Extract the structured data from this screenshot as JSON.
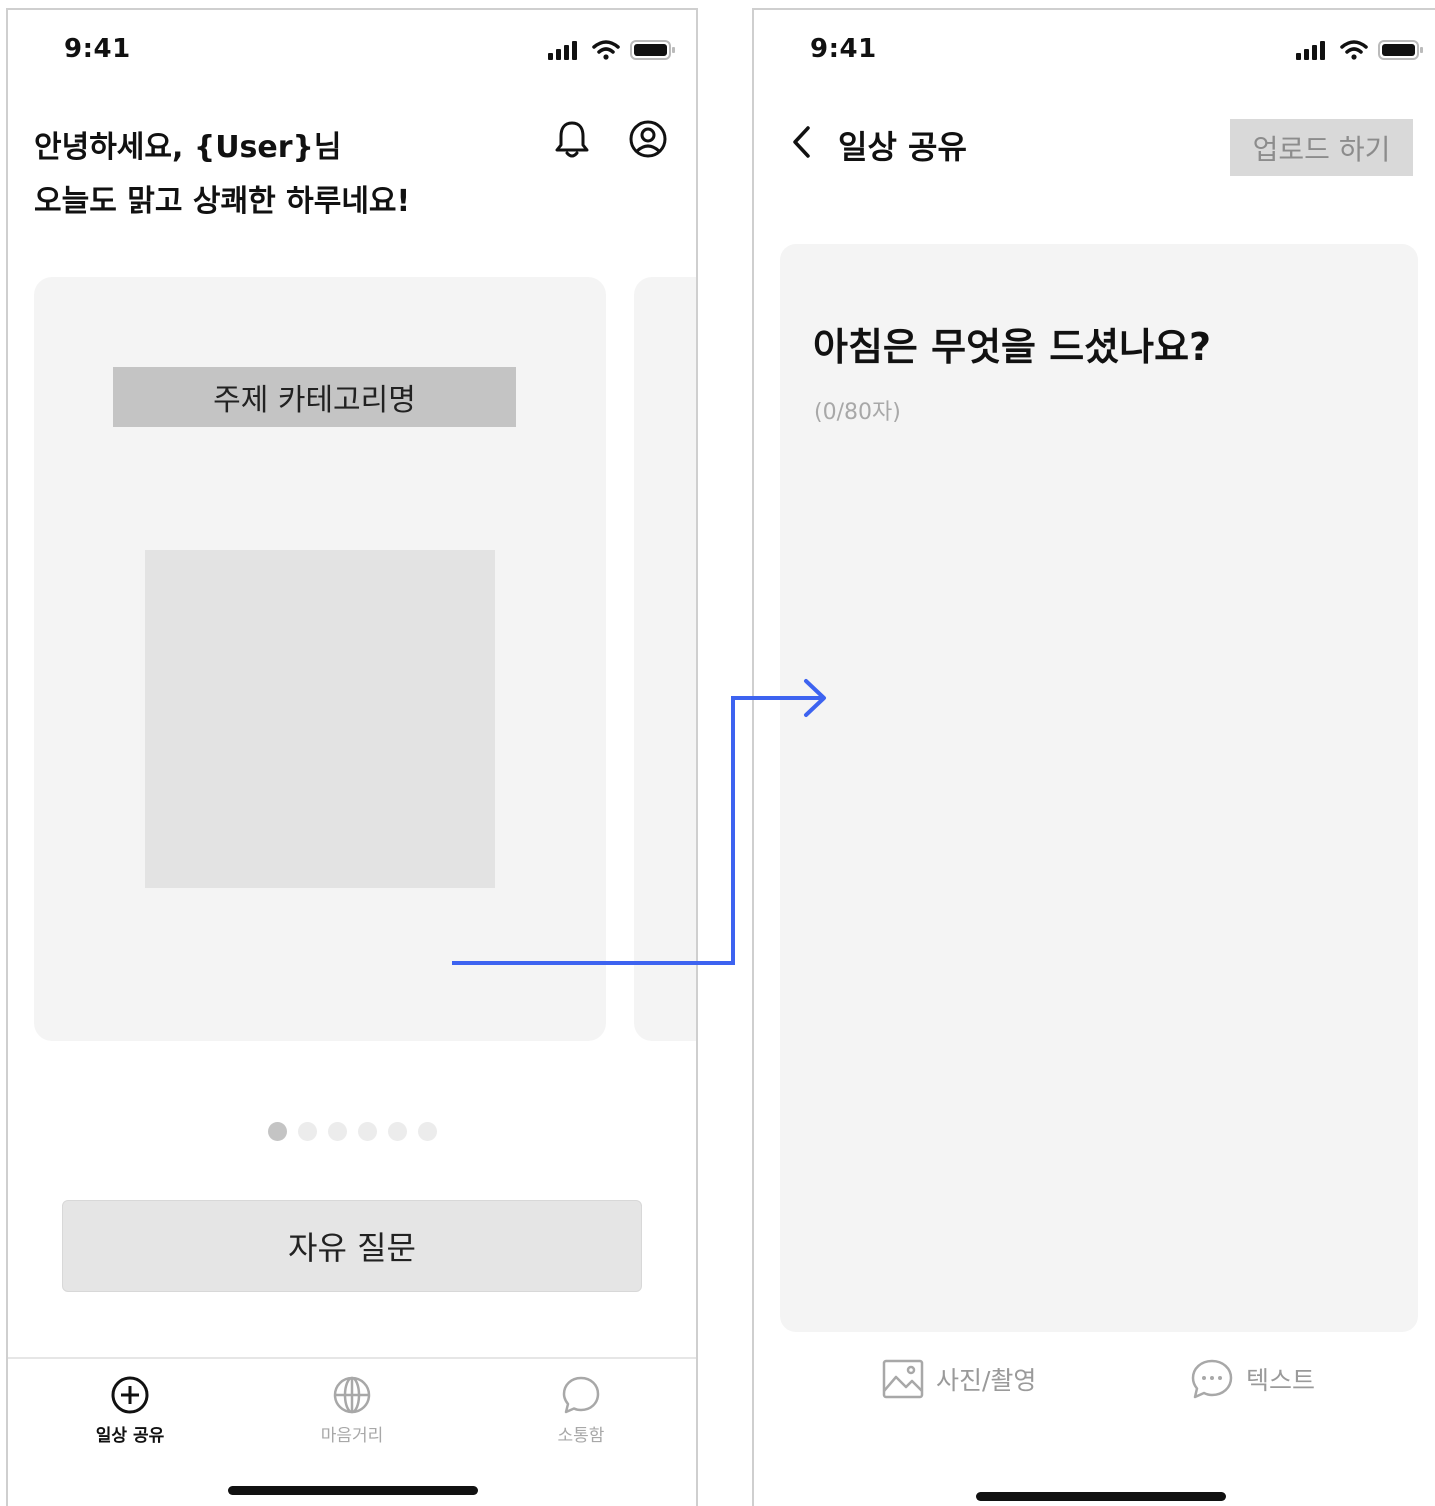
{
  "left_screen": {
    "status_time": "9:41",
    "greeting_line1": "안녕하세요, {User}님",
    "greeting_line2": "오늘도 맑고 상쾌한 하루네요!",
    "icons": {
      "notification": "bell-icon",
      "profile": "user-circle-icon"
    },
    "card": {
      "category": "주제 카테고리명"
    },
    "pagination": {
      "total": 6,
      "active_index": 0
    },
    "free_question_label": "자유 질문",
    "tabs": [
      {
        "label": "일상 공유",
        "icon": "plus-circle-icon",
        "active": true
      },
      {
        "label": "마음거리",
        "icon": "globe-icon",
        "active": false
      },
      {
        "label": "소통함",
        "icon": "chat-bubble-icon",
        "active": false
      }
    ]
  },
  "right_screen": {
    "status_time": "9:41",
    "title": "일상 공유",
    "upload_label": "업로드 하기",
    "question": "아침은 무엇을 드셨나요?",
    "char_count": "(0/80자)",
    "tools": [
      {
        "label": "사진/촬영",
        "icon": "image-icon"
      },
      {
        "label": "텍스트",
        "icon": "chat-dots-icon"
      }
    ]
  },
  "colors": {
    "flow_arrow": "#3d63f0",
    "card_bg": "#f4f4f4",
    "placeholder": "#c4c4c4"
  }
}
